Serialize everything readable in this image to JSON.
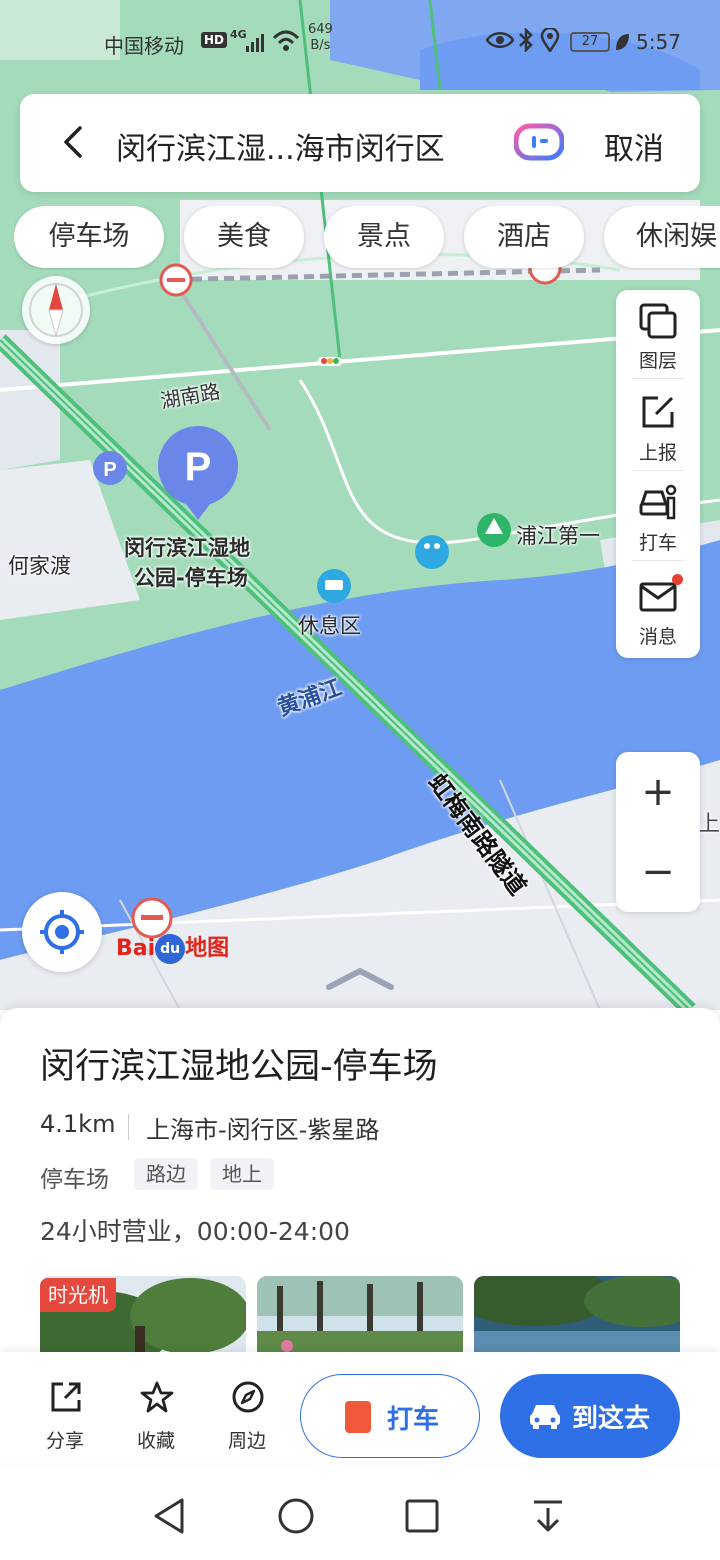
{
  "status_bar": {
    "carrier": "中国移动",
    "hd": "HD",
    "network": "4G",
    "speed_value": "649",
    "speed_unit": "B/s",
    "battery": "27",
    "time": "5:57"
  },
  "search": {
    "query": "闵行滨江湿...海市闵行区",
    "cancel_label": "取消"
  },
  "categories": [
    "停车场",
    "美食",
    "景点",
    "酒店",
    "休闲娱"
  ],
  "map": {
    "labels": {
      "hunan_road": "湖南路",
      "hejiadu": "何家渡",
      "parking_poi": "闵行滨江湿地",
      "parking_poi_line2": "公园-停车场",
      "rest_area": "休息区",
      "pujiang": "浦江第一",
      "huangpu_river": "黄浦江",
      "tunnel": "虹梅南路隧道",
      "edge_text": "上"
    },
    "colors": {
      "green_area": "#9fd9b6",
      "water": "#6e9cf2",
      "road_green": "#4fbf7c",
      "pin_blue": "#6a86e8"
    }
  },
  "tools": [
    {
      "label": "图层",
      "icon": "layers-icon"
    },
    {
      "label": "上报",
      "icon": "report-edit-icon"
    },
    {
      "label": "打车",
      "icon": "taxi-icon"
    },
    {
      "label": "消息",
      "icon": "mail-icon"
    }
  ],
  "zoom": {
    "in_label": "+",
    "out_label": "−"
  },
  "logo": {
    "bai": "Bai",
    "du": "du",
    "ditu": "地图"
  },
  "place": {
    "title": "闵行滨江湿地公园-停车场",
    "distance": "4.1km",
    "address": "上海市-闵行区-紫星路",
    "category": "停车场",
    "tags": [
      "路边",
      "地上"
    ],
    "hours": "24小时营业，00:00-24:00",
    "photo_badge": "时光机"
  },
  "actions": {
    "share": "分享",
    "favorite": "收藏",
    "nearby": "周边",
    "taxi": "打车",
    "go_here": "到这去"
  },
  "accent_color": "#2f6fe5"
}
